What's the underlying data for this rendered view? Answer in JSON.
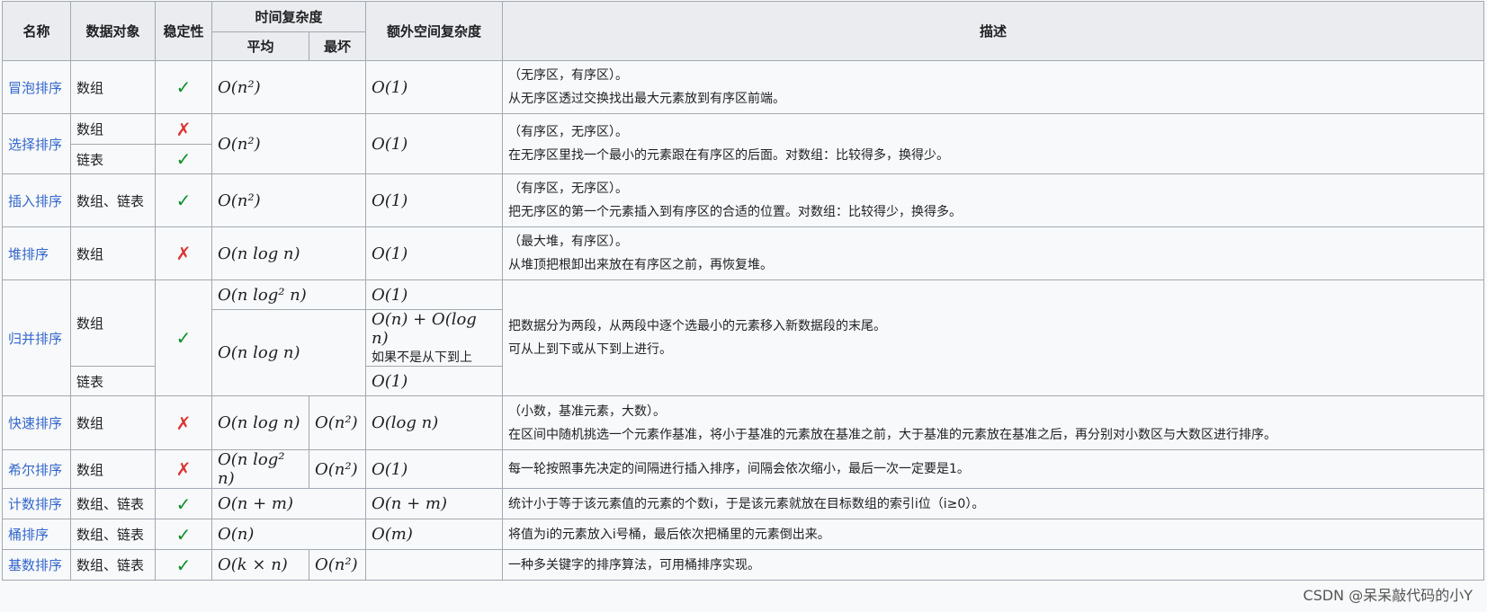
{
  "headers": {
    "name": "名称",
    "data_object": "数据对象",
    "stability": "稳定性",
    "time_complexity": "时间复杂度",
    "average": "平均",
    "worst": "最坏",
    "space": "额外空间复杂度",
    "description": "描述"
  },
  "marks": {
    "yes": "✓",
    "no": "✗"
  },
  "rows": {
    "bubble": {
      "name": "冒泡排序",
      "obj": "数组",
      "stable": "✓",
      "avg": "O(n²)",
      "space": "O(1)",
      "desc1": "（无序区，有序区）。",
      "desc2": "从无序区透过交换找出最大元素放到有序区前端。"
    },
    "selection": {
      "name": "选择排序",
      "obj1": "数组",
      "stable1": "✗",
      "obj2": "链表",
      "stable2": "✓",
      "avg": "O(n²)",
      "space": "O(1)",
      "desc1": "（有序区，无序区）。",
      "desc2": "在无序区里找一个最小的元素跟在有序区的后面。对数组：比较得多，换得少。"
    },
    "insertion": {
      "name": "插入排序",
      "obj": "数组、链表",
      "stable": "✓",
      "avg": "O(n²)",
      "space": "O(1)",
      "desc1": "（有序区，无序区）。",
      "desc2": "把无序区的第一个元素插入到有序区的合适的位置。对数组：比较得少，换得多。"
    },
    "heap": {
      "name": "堆排序",
      "obj": "数组",
      "stable": "✗",
      "avg": "O(n log n)",
      "space": "O(1)",
      "desc1": "（最大堆，有序区）。",
      "desc2": "从堆顶把根卸出来放在有序区之前，再恢复堆。"
    },
    "merge": {
      "name": "归并排序",
      "obj1": "数组",
      "obj2": "链表",
      "stable": "✓",
      "avg1": "O(n log² n)",
      "space1": "O(1)",
      "avg2": "O(n log n)",
      "space2": "O(n) + O(log n)",
      "space2_note": "如果不是从下到上",
      "space3": "O(1)",
      "desc1": "把数据分为两段，从两段中逐个选最小的元素移入新数据段的末尾。",
      "desc2": "可从上到下或从下到上进行。"
    },
    "quick": {
      "name": "快速排序",
      "obj": "数组",
      "stable": "✗",
      "avg": "O(n log n)",
      "worst": "O(n²)",
      "space": "O(log n)",
      "desc1": "（小数，基准元素，大数）。",
      "desc2": "在区间中随机挑选一个元素作基准，将小于基准的元素放在基准之前，大于基准的元素放在基准之后，再分别对小数区与大数区进行排序。"
    },
    "shell": {
      "name": "希尔排序",
      "obj": "数组",
      "stable": "✗",
      "avg": "O(n log² n)",
      "worst": "O(n²)",
      "space": "O(1)",
      "desc1": "每一轮按照事先决定的间隔进行插入排序，间隔会依次缩小，最后一次一定要是1。"
    },
    "counting": {
      "name": "计数排序",
      "obj": "数组、链表",
      "stable": "✓",
      "avg": "O(n + m)",
      "space": "O(n + m)",
      "desc1": "统计小于等于该元素值的元素的个数i，于是该元素就放在目标数组的索引i位（i≥0）。"
    },
    "bucket": {
      "name": "桶排序",
      "obj": "数组、链表",
      "stable": "✓",
      "avg": "O(n)",
      "space": "O(m)",
      "desc1": "将值为i的元素放入i号桶，最后依次把桶里的元素倒出来。"
    },
    "radix": {
      "name": "基数排序",
      "obj": "数组、链表",
      "stable": "✓",
      "avg": "O(k × n)",
      "worst": "O(n²)",
      "space": "",
      "desc1": "一种多关键字的排序算法，可用桶排序实现。"
    }
  },
  "watermark": "CSDN @呆呆敲代码的小Y"
}
